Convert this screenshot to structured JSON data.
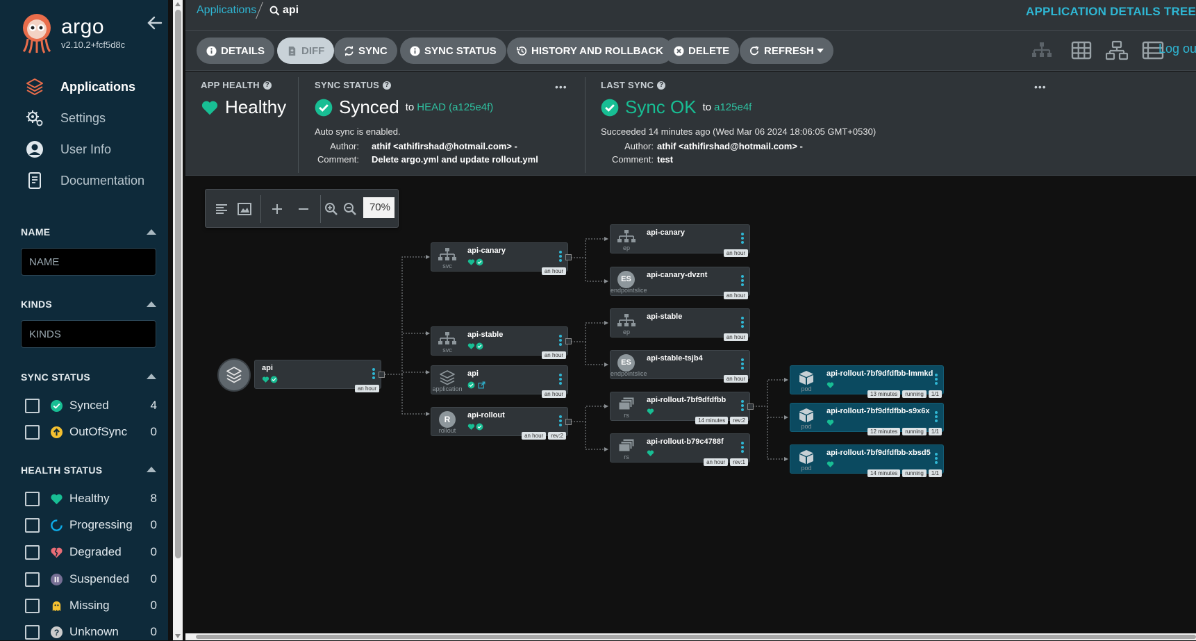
{
  "app": {
    "brand": "argo",
    "version": "v2.10.2+fcf5d8c",
    "page_title": "APPLICATION DETAILS TREE"
  },
  "sidebar": {
    "nav": [
      {
        "label": "Applications",
        "icon": "layers-icon",
        "active": true
      },
      {
        "label": "Settings",
        "icon": "gears-icon",
        "active": false
      },
      {
        "label": "User Info",
        "icon": "user-circle-icon",
        "active": false
      },
      {
        "label": "Documentation",
        "icon": "book-icon",
        "active": false
      }
    ],
    "filters": {
      "name": {
        "title": "NAME",
        "placeholder": "NAME"
      },
      "kinds": {
        "title": "KINDS",
        "placeholder": "KINDS"
      },
      "sync_status": {
        "title": "SYNC STATUS",
        "items": [
          {
            "label": "Synced",
            "count": "4",
            "icon": "check-circle-icon",
            "color": "#18be94"
          },
          {
            "label": "OutOfSync",
            "count": "0",
            "icon": "arrow-up-circle-icon",
            "color": "#f4c030"
          }
        ]
      },
      "health_status": {
        "title": "HEALTH STATUS",
        "items": [
          {
            "label": "Healthy",
            "count": "8",
            "icon": "heart-icon",
            "color": "#18be94"
          },
          {
            "label": "Progressing",
            "count": "0",
            "icon": "progress-circle-icon",
            "color": "#0dadea"
          },
          {
            "label": "Degraded",
            "count": "0",
            "icon": "broken-heart-icon",
            "color": "#e96d76"
          },
          {
            "label": "Suspended",
            "count": "0",
            "icon": "pause-circle-icon",
            "color": "#766f94"
          },
          {
            "label": "Missing",
            "count": "0",
            "icon": "ghost-icon",
            "color": "#f4c030"
          },
          {
            "label": "Unknown",
            "count": "0",
            "icon": "question-circle-icon",
            "color": "#cccccc"
          }
        ]
      }
    }
  },
  "breadcrumb": {
    "root": "Applications",
    "current": "api"
  },
  "toolbar": {
    "details": "DETAILS",
    "diff": "DIFF",
    "sync": "SYNC",
    "sync_status": "SYNC STATUS",
    "history": "HISTORY AND ROLLBACK",
    "delete": "DELETE",
    "refresh": "REFRESH",
    "logout": "Log ou"
  },
  "status": {
    "health": {
      "title": "APP HEALTH",
      "value": "Healthy"
    },
    "sync": {
      "title": "SYNC STATUS",
      "value": "Synced",
      "to_label": "to",
      "revision": "HEAD (a125e4f)",
      "auto_sync": "Auto sync is enabled.",
      "author_key": "Author:",
      "author": "athif <athifirshad@hotmail.com> -",
      "comment_key": "Comment:",
      "comment": "Delete argo.yml and update rollout.yml"
    },
    "last_sync": {
      "title": "LAST SYNC",
      "value": "Sync OK",
      "to_label": "to",
      "revision": "a125e4f",
      "time": "Succeeded 14 minutes ago (Wed Mar 06 2024 18:06:05 GMT+0530)",
      "author_key": "Author:",
      "author": "athif <athifirshad@hotmail.com> -",
      "comment_key": "Comment:",
      "comment": "test"
    },
    "more": "•••"
  },
  "graph": {
    "zoom": "70%",
    "nodes": {
      "api": {
        "name": "api",
        "tags": [
          "an hour"
        ]
      },
      "svc_canary": {
        "name": "api-canary",
        "kind": "svc",
        "tags": [
          "an hour"
        ]
      },
      "svc_stable": {
        "name": "api-stable",
        "kind": "svc",
        "tags": [
          "an hour"
        ]
      },
      "app_api": {
        "name": "api",
        "kind": "application",
        "tags": [
          "an hour"
        ]
      },
      "rollout": {
        "name": "api-rollout",
        "kind": "rollout",
        "badge": "R",
        "tags": [
          "an hour",
          "rev:2"
        ]
      },
      "ep_canary": {
        "name": "api-canary",
        "kind": "ep",
        "tags": [
          "an hour"
        ]
      },
      "es_canary": {
        "name": "api-canary-dvznt",
        "kind": "endpointslice",
        "badge": "ES",
        "tags": [
          "an hour"
        ]
      },
      "ep_stable": {
        "name": "api-stable",
        "kind": "ep",
        "tags": [
          "an hour"
        ]
      },
      "es_stable": {
        "name": "api-stable-tsjb4",
        "kind": "endpointslice",
        "badge": "ES",
        "tags": [
          "an hour"
        ]
      },
      "rs1": {
        "name": "api-rollout-7bf9dfdfbb",
        "kind": "rs",
        "tags": [
          "14 minutes",
          "rev:2"
        ]
      },
      "rs2": {
        "name": "api-rollout-b79c4788f",
        "kind": "rs",
        "tags": [
          "an hour",
          "rev:1"
        ]
      },
      "pod1": {
        "name": "api-rollout-7bf9dfdfbb-lmmkd",
        "kind": "pod",
        "tags": [
          "13 minutes",
          "running",
          "1/1"
        ]
      },
      "pod2": {
        "name": "api-rollout-7bf9dfdfbb-s9x6x",
        "kind": "pod",
        "tags": [
          "12 minutes",
          "running",
          "1/1"
        ]
      },
      "pod3": {
        "name": "api-rollout-7bf9dfdfbb-xbsd5",
        "kind": "pod",
        "tags": [
          "14 minutes",
          "running",
          "1/1"
        ]
      }
    }
  },
  "colors": {
    "accent": "#2fb6d3",
    "healthy": "#18be94",
    "sidebar": "#0e2a3a",
    "panel": "#2f3438"
  }
}
